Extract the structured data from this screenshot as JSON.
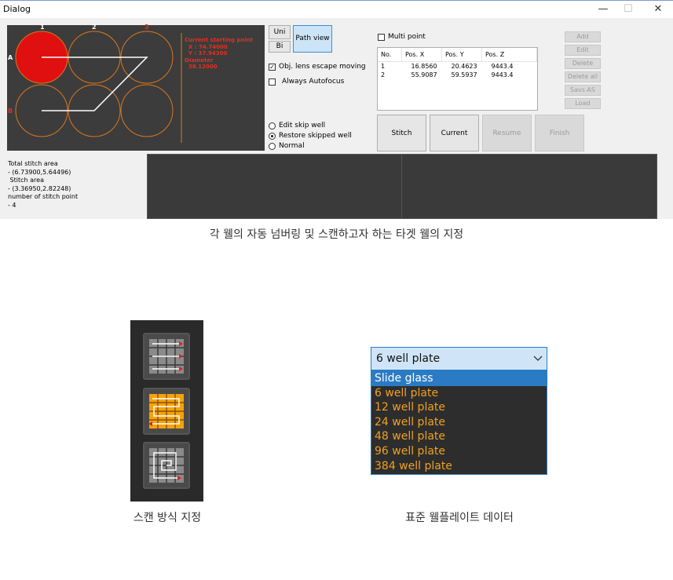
{
  "window": {
    "title": "Dialog",
    "minimize_glyph": "—",
    "maximize_glyph": "☐",
    "close_glyph": "✕"
  },
  "well_panel": {
    "column_labels": [
      "1",
      "2",
      "3"
    ],
    "row_labels": [
      "A",
      "B"
    ],
    "info_lines": "Current starting point\n  X : 74.74000\n  Y : 37.94300\nDiameter\n  38.12000",
    "colors": {
      "background": "#3c3c3c",
      "well_outline": "#d9771e",
      "selected_well": "#e01010",
      "path": "#ffffff",
      "label_red": "#e03020"
    }
  },
  "scan_buttons": {
    "uni": "Uni",
    "bi": "Bi",
    "path_view": "Path view"
  },
  "options": {
    "obj_lens_escape": {
      "label": "Obj. lens escape moving",
      "checked": true
    },
    "always_autofocus": {
      "label": "Always Autofocus",
      "checked": false
    },
    "radios": [
      {
        "label": "Edit skip well",
        "selected": false
      },
      {
        "label": "Restore skipped well",
        "selected": true
      },
      {
        "label": "Normal",
        "selected": false
      }
    ]
  },
  "points": {
    "multi_point_label": "Multi point",
    "multi_point_checked": false,
    "columns": [
      "No.",
      "Pos. X",
      "Pos. Y",
      "Pos. Z"
    ],
    "rows": [
      [
        "1",
        "16.8560",
        "20.4623",
        "9443.4"
      ],
      [
        "2",
        "55.9087",
        "59.5937",
        "9443.4"
      ]
    ]
  },
  "right_buttons": [
    "Add",
    "Edit",
    "Delete",
    "Delete all",
    "Savs AS",
    "Load"
  ],
  "action_buttons": {
    "stitch": "Stitch",
    "current": "Current",
    "resume": "Resume",
    "finish": "Finish"
  },
  "stitch_info": {
    "line1": "Total stitch area",
    "line2": "- (6.73900,5.64496)",
    "line3": " Stitch area",
    "line4": "- (3.36950,2.82248)",
    "line5": "number of stitch point",
    "line6": "- 4"
  },
  "captions": {
    "top": "각 웰의 자동 넘버링 및 스캔하고자 하는 타겟 웰의 지정",
    "scan_mode": "스캔 방식 지정",
    "plate_data": "표준 웰플레이트 데이터"
  },
  "plate_dropdown": {
    "selected": "6 well plate",
    "options": [
      "Slide glass",
      "6 well plate",
      "12 well plate",
      "24 well plate",
      "48 well plate",
      "96 well plate",
      "384 well plate"
    ],
    "highlighted_index": 0,
    "chevron_icon": "chevron-down-icon"
  },
  "scan_mode_icons": [
    {
      "name": "unidirectional-scan-icon",
      "active": false
    },
    {
      "name": "bidirectional-scan-icon",
      "active": true
    },
    {
      "name": "spiral-scan-icon",
      "active": false
    }
  ]
}
